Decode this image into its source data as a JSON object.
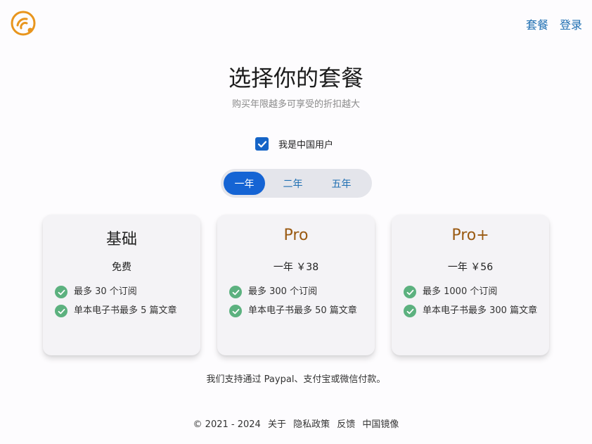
{
  "header": {
    "logo_icon": "rss-feed-icon",
    "nav": [
      {
        "label": "套餐"
      },
      {
        "label": "登录"
      }
    ]
  },
  "hero": {
    "title": "选择你的套餐",
    "subtitle": "购买年限越多可享受的折扣越大"
  },
  "china_user": {
    "label": "我是中国用户",
    "checked": true
  },
  "period_toggle": {
    "options": [
      "一年",
      "二年",
      "五年"
    ],
    "selected": "一年"
  },
  "plans": [
    {
      "name": "基础",
      "price": "免费",
      "features": [
        "最多 30 个订阅",
        "单本电子书最多 5 篇文章"
      ]
    },
    {
      "name": "Pro",
      "price": "一年 ￥38",
      "features": [
        "最多 300 个订阅",
        "单本电子书最多 50 篇文章"
      ]
    },
    {
      "name": "Pro+",
      "price": "一年 ￥56",
      "features": [
        "最多 1000 个订阅",
        "单本电子书最多 300 篇文章"
      ]
    }
  ],
  "payment_note": "我们支持通过 Paypal、支付宝或微信付款。",
  "footer": {
    "copyright": "© 2021 - 2024",
    "links": [
      "关于",
      "隐私政策",
      "反馈",
      "中国镜像"
    ]
  },
  "colors": {
    "accent_blue": "#1564d4",
    "pro_name": "#9a5a12",
    "check_green": "#5cb17f",
    "logo_orange": "#e8951d"
  }
}
